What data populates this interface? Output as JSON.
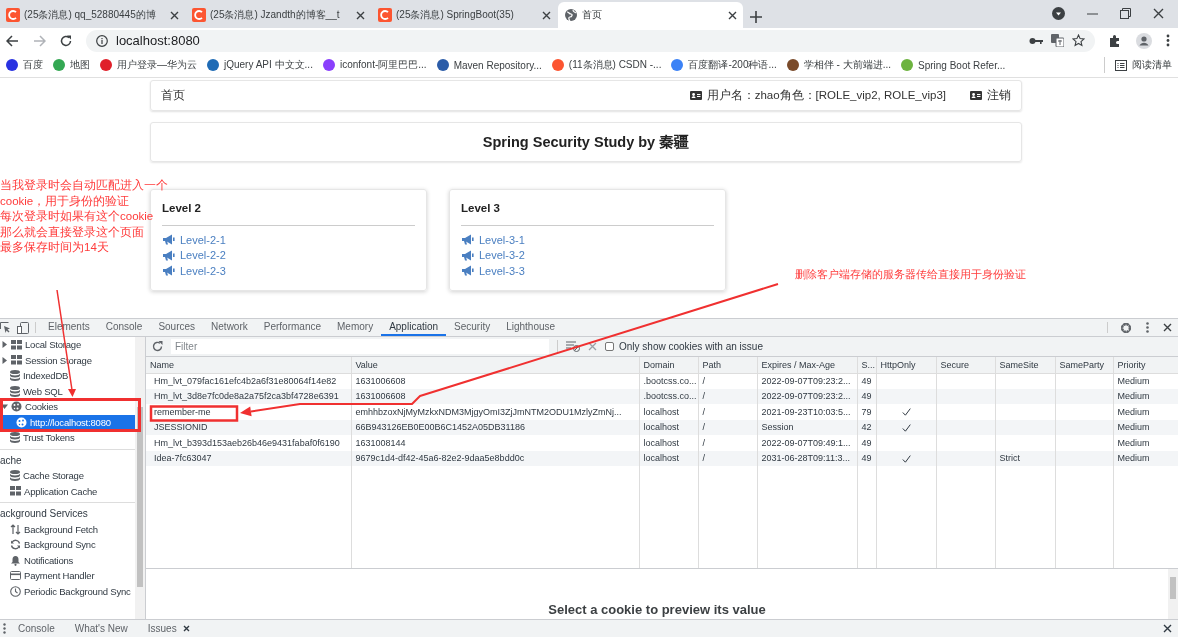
{
  "browser": {
    "tabs": [
      {
        "title": "(25条消息) qq_52880445的博",
        "selected": false
      },
      {
        "title": "(25条消息) Jzandth的博客__t",
        "selected": false
      },
      {
        "title": "(25条消息) SpringBoot(35)",
        "selected": false
      },
      {
        "title": "首页",
        "selected": true
      }
    ],
    "address": "localhost:8080",
    "bookmarks": [
      {
        "label": "百度",
        "color": "#2932e1"
      },
      {
        "label": "地图",
        "color": "#34a853"
      },
      {
        "label": "用户登录—华为云",
        "color": "#e0202a"
      },
      {
        "label": "jQuery API 中文文...",
        "color": "#1f6bb5"
      },
      {
        "label": "iconfont-阿里巴巴...",
        "color": "#8a3ffc"
      },
      {
        "label": "Maven Repository...",
        "color": "#2b5ca8"
      },
      {
        "label": "(11条消息) CSDN -...",
        "color": "#fc5531"
      },
      {
        "label": "百度翻译-200种语...",
        "color": "#3b82f6"
      },
      {
        "label": "学相伴 - 大前端进...",
        "color": "#7a4a2a"
      },
      {
        "label": "Spring Boot Refer...",
        "color": "#6db33f"
      }
    ],
    "reading_list": "阅读清单"
  },
  "page": {
    "nav": {
      "home": "首页",
      "user": "用户名：zhao角色：[ROLE_vip2, ROLE_vip3]",
      "logout": "注销"
    },
    "title": "Spring Security Study by 秦疆",
    "cards": [
      {
        "title": "Level 2",
        "links": [
          "Level-2-1",
          "Level-2-2",
          "Level-2-3"
        ]
      },
      {
        "title": "Level 3",
        "links": [
          "Level-3-1",
          "Level-3-2",
          "Level-3-3"
        ]
      }
    ]
  },
  "annotations": {
    "left_note": [
      "当我登录时会自动匹配进入一个",
      "cookie，用于身份的验证",
      "每次登录时如果有这个cookie",
      "那么就会直接登录这个页面",
      "最多保存时间为14天"
    ],
    "right_note": "删除客户端存储的服务器传给直接用于身份验证"
  },
  "devtools": {
    "tabs": [
      {
        "label": "Elements",
        "selected": false
      },
      {
        "label": "Console",
        "selected": false
      },
      {
        "label": "Sources",
        "selected": false
      },
      {
        "label": "Network",
        "selected": false
      },
      {
        "label": "Performance",
        "selected": false
      },
      {
        "label": "Memory",
        "selected": false
      },
      {
        "label": "Application",
        "selected": true
      },
      {
        "label": "Security",
        "selected": false
      },
      {
        "label": "Lighthouse",
        "selected": false
      }
    ],
    "sidebar": [
      {
        "items": [
          {
            "label": "Local Storage",
            "kind": "grid",
            "expanded": false,
            "selected": false
          },
          {
            "label": "Session Storage",
            "kind": "grid",
            "expanded": false,
            "selected": false
          },
          {
            "label": "IndexedDB",
            "kind": "db",
            "selected": false
          },
          {
            "label": "Web SQL",
            "kind": "db",
            "selected": false
          },
          {
            "label": "Cookies",
            "kind": "cookie",
            "expanded": true,
            "selected": false,
            "children": [
              {
                "label": "http://localhost:8080",
                "kind": "cookie",
                "selected": true
              }
            ]
          },
          {
            "label": "Trust Tokens",
            "kind": "db",
            "selected": false
          }
        ]
      },
      {
        "heading": "ache",
        "items": [
          {
            "label": "Cache Storage",
            "kind": "db",
            "selected": false
          },
          {
            "label": "Application Cache",
            "kind": "grid",
            "selected": false
          }
        ]
      },
      {
        "heading": "ackground Services",
        "items": [
          {
            "label": "Background Fetch",
            "kind": "arrows",
            "selected": false
          },
          {
            "label": "Background Sync",
            "kind": "sync",
            "selected": false
          },
          {
            "label": "Notifications",
            "kind": "bell",
            "selected": false
          },
          {
            "label": "Payment Handler",
            "kind": "card",
            "selected": false
          },
          {
            "label": "Periodic Background Sync",
            "kind": "clock",
            "selected": false
          }
        ]
      }
    ],
    "filter": {
      "placeholder": "Filter"
    },
    "issue_filter": {
      "label": "Only show cookies with an issue",
      "checked": false
    },
    "columns": [
      "Name",
      "Value",
      "Domain",
      "Path",
      "Expires / Max-Age",
      "S...",
      "HttpOnly",
      "Secure",
      "SameSite",
      "SameParty",
      "Priority"
    ],
    "rows": [
      {
        "name": "Hm_lvt_079fac161efc4b2a6f31e80064f14e82",
        "value": "1631006608",
        "domain": ".bootcss.co...",
        "path": "/",
        "expires": "2022-09-07T09:23:2...",
        "size": "49",
        "http_only": false,
        "priority": "Medium"
      },
      {
        "name": "Hm_lvt_3d8e7fc0de8a2a75f2ca3bf4728e6391",
        "value": "1631006608",
        "domain": ".bootcss.co...",
        "path": "/",
        "expires": "2022-09-07T09:23:2...",
        "size": "49",
        "http_only": false,
        "priority": "Medium"
      },
      {
        "name": "remember-me",
        "value": "emhhbzoxNjMyMzkxNDM3MjgyOmI3ZjJmNTM2ODU1MzlyZmNj...",
        "domain": "localhost",
        "path": "/",
        "expires": "2021-09-23T10:03:5...",
        "size": "79",
        "http_only": true,
        "priority": "Medium"
      },
      {
        "name": "JSESSIONID",
        "value": "66B943126EB0E00B6C1452A05DB31186",
        "domain": "localhost",
        "path": "/",
        "expires": "Session",
        "size": "42",
        "http_only": true,
        "priority": "Medium"
      },
      {
        "name": "Hm_lvt_b393d153aeb26b46e9431fabaf0f6190",
        "value": "1631008144",
        "domain": "localhost",
        "path": "/",
        "expires": "2022-09-07T09:49:1...",
        "size": "49",
        "http_only": false,
        "priority": "Medium"
      },
      {
        "name": "Idea-7fc63047",
        "value": "9679c1d4-df42-45a6-82e2-9daa5e8bdd0c",
        "domain": "localhost",
        "path": "/",
        "expires": "2031-06-28T09:11:3...",
        "size": "49",
        "http_only": true,
        "same_site": "Strict",
        "priority": "Medium"
      }
    ],
    "preview": "Select a cookie to preview its value",
    "drawer_tabs": [
      {
        "label": "Console",
        "closable": false
      },
      {
        "label": "What's New",
        "closable": false
      },
      {
        "label": "Issues",
        "closable": true
      }
    ]
  }
}
